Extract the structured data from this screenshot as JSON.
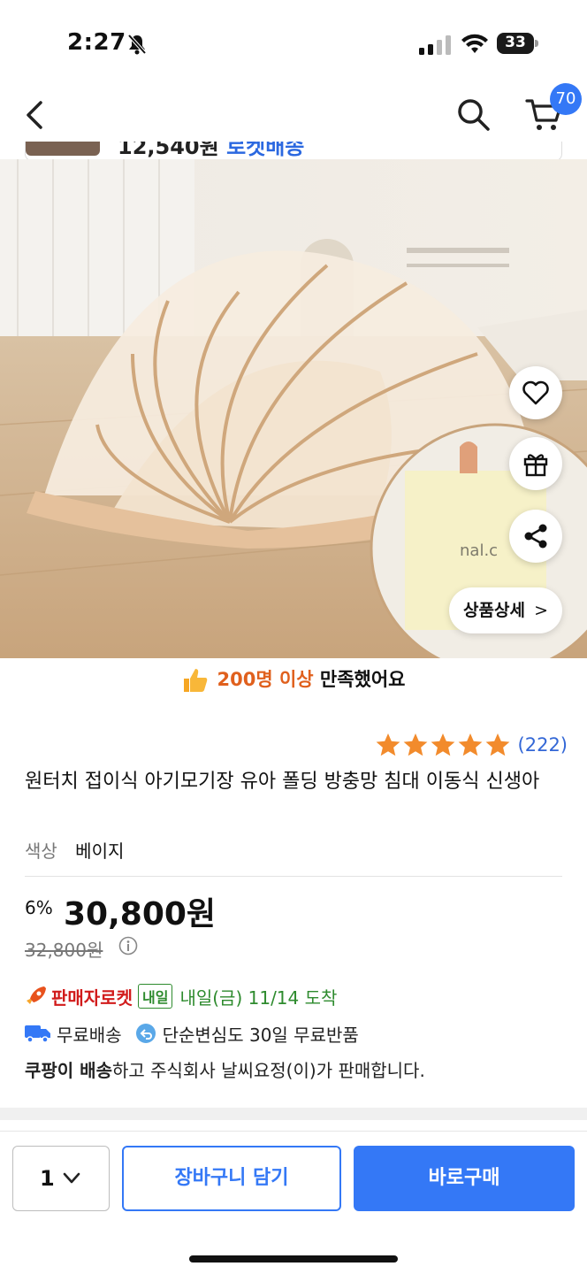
{
  "status_bar": {
    "time": "2:27",
    "battery": "33",
    "icons": [
      "bell-slash-icon",
      "signal-icon",
      "wifi-icon",
      "battery-icon"
    ]
  },
  "nav": {
    "back_icon": "chevron-left-icon",
    "search_icon": "search-icon",
    "cart_icon": "cart-icon",
    "cart_count": "70"
  },
  "peek": {
    "price": "12,540원",
    "tag": "로켓배송"
  },
  "hero": {
    "product_alt": "beige foldable baby mosquito net",
    "logo_text": "nal.c",
    "floating_icons": [
      "heart-icon",
      "gift-icon",
      "share-icon"
    ],
    "detail_button": "상품상세",
    "detail_chevron": ">"
  },
  "satisfaction": {
    "highlight": "200명 이상",
    "rest": " 만족했어요",
    "icon": "thumbs-up-icon"
  },
  "rating": {
    "stars": 5,
    "review_count": "(222)",
    "star_color": "#f28b2c"
  },
  "product": {
    "title": "원터치 접이식 아기모기장 유아 폴딩 방충망 침대 이동식 신생아",
    "option_label": "색상",
    "option_value": "베이지"
  },
  "price": {
    "discount": "6%",
    "sale_price": "30,800원",
    "original_price": "32,800원"
  },
  "delivery": {
    "rocket_label": "판매자로켓",
    "badge": "내일",
    "arrival": "내일(금) 11/14 도착",
    "free_shipping": "무료배송",
    "return_policy": "단순변심도 30일 무료반품",
    "seller_bold": "쿠팡이 배송",
    "seller_rest": "하고 주식회사 날씨요정(이)가 판매합니다."
  },
  "bottom": {
    "quantity": "1",
    "add_to_cart": "장바구니 담기",
    "buy_now": "바로구매"
  },
  "colors": {
    "accent": "#3478f6",
    "rocket_red": "#d11b1b",
    "arrival_green": "#2e8b2e",
    "satisfaction_orange": "#e0601d"
  }
}
